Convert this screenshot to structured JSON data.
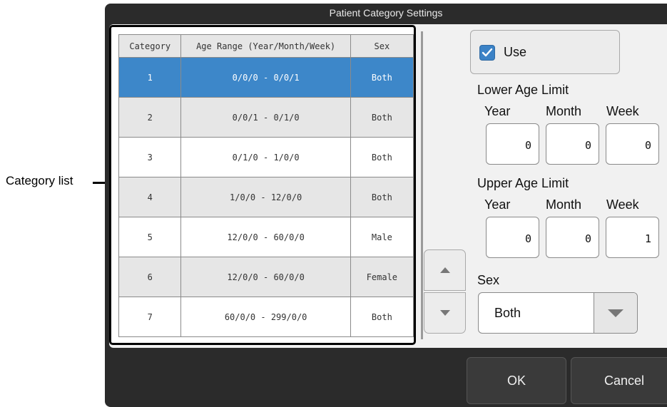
{
  "annotation": {
    "category_list_label": "Category list"
  },
  "dialog": {
    "title": "Patient Category Settings"
  },
  "table": {
    "headers": [
      "Category",
      "Age Range (Year/Month/Week)",
      "Sex"
    ],
    "rows": [
      {
        "category": "1",
        "range": "0/0/0 - 0/0/1",
        "sex": "Both"
      },
      {
        "category": "2",
        "range": "0/0/1 - 0/1/0",
        "sex": "Both"
      },
      {
        "category": "3",
        "range": "0/1/0 - 1/0/0",
        "sex": "Both"
      },
      {
        "category": "4",
        "range": "1/0/0 - 12/0/0",
        "sex": "Both"
      },
      {
        "category": "5",
        "range": "12/0/0 - 60/0/0",
        "sex": "Male"
      },
      {
        "category": "6",
        "range": "12/0/0 - 60/0/0",
        "sex": "Female"
      },
      {
        "category": "7",
        "range": "60/0/0 - 299/0/0",
        "sex": "Both"
      }
    ],
    "selected_row": 1
  },
  "use": {
    "label": "Use",
    "checked": true
  },
  "lower_limit": {
    "label": "Lower Age Limit",
    "year_label": "Year",
    "month_label": "Month",
    "week_label": "Week",
    "year": "0",
    "month": "0",
    "week": "0"
  },
  "upper_limit": {
    "label": "Upper Age Limit",
    "year_label": "Year",
    "month_label": "Month",
    "week_label": "Week",
    "year": "0",
    "month": "0",
    "week": "1"
  },
  "sex": {
    "label": "Sex",
    "value": "Both"
  },
  "footer": {
    "ok_label": "OK",
    "cancel_label": "Cancel"
  },
  "icons": {
    "scroll_up": "triangle-up-icon",
    "scroll_down": "triangle-down-icon",
    "dropdown": "chevron-down-icon",
    "check": "check-icon"
  },
  "colors": {
    "selection": "#3d87c9",
    "dialog_bg": "#2b2b2b",
    "panel_bg": "#f1f1f1",
    "checkbox": "#3b82c6"
  }
}
